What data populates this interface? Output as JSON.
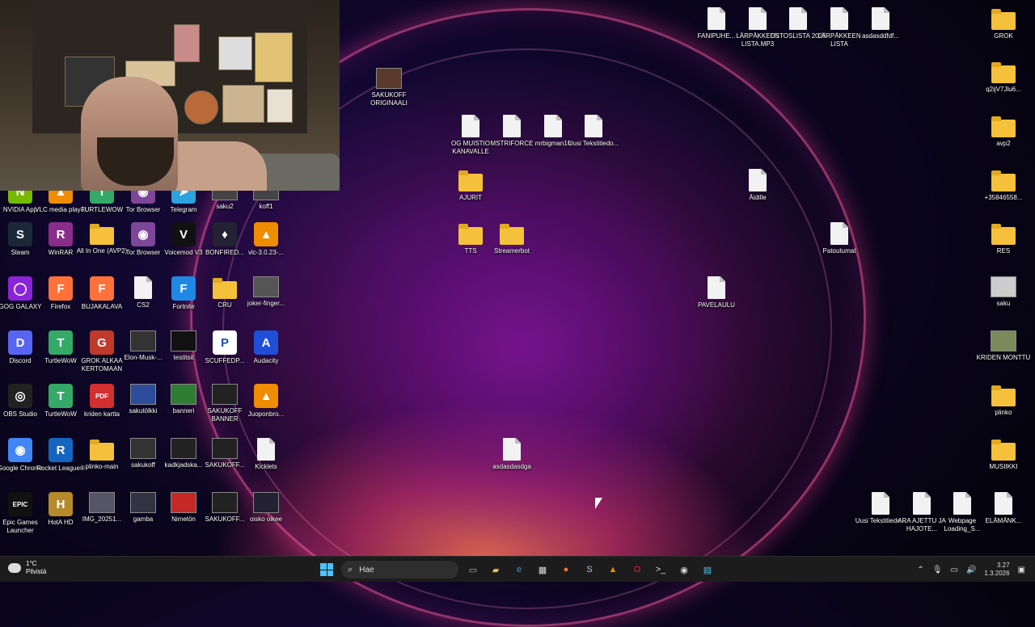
{
  "desktop_icons": [
    {
      "label": "NVIDIA App",
      "type": "app",
      "color": "#76b900",
      "glyph": "N"
    },
    {
      "label": "VLC media player",
      "type": "app",
      "color": "#f08c00",
      "glyph": "▲"
    },
    {
      "label": "TURTLEWOW",
      "type": "app",
      "color": "#3a6",
      "glyph": "T"
    },
    {
      "label": "Tor Browser",
      "type": "app",
      "color": "#7d4698",
      "glyph": "◉"
    },
    {
      "label": "Telegram",
      "type": "app",
      "color": "#2aa3de",
      "glyph": "➤"
    },
    {
      "label": "saku2",
      "type": "image",
      "color": "#444",
      "glyph": ""
    },
    {
      "label": "koff1",
      "type": "image",
      "color": "#444",
      "glyph": ""
    },
    {
      "label": "Steam",
      "type": "app",
      "color": "#1b2838",
      "glyph": "S"
    },
    {
      "label": "WinRAR",
      "type": "app",
      "color": "#8a2d8a",
      "glyph": "R"
    },
    {
      "label": "All In One (AVP2)",
      "type": "folder",
      "color": "#f5c13a",
      "glyph": ""
    },
    {
      "label": "Tor Browser",
      "type": "app",
      "color": "#7d4698",
      "glyph": "◉"
    },
    {
      "label": "Voicemod V3",
      "type": "app",
      "color": "#111",
      "glyph": "V"
    },
    {
      "label": "BONFIRED...",
      "type": "app",
      "color": "#223",
      "glyph": "♦"
    },
    {
      "label": "vlc-3.0.23-...",
      "type": "app",
      "color": "#f08c00",
      "glyph": "▲"
    },
    {
      "label": "GOG GALAXY",
      "type": "app",
      "color": "#8a24d8",
      "glyph": "◯"
    },
    {
      "label": "Firefox",
      "type": "app",
      "color": "#ff7139",
      "glyph": "F"
    },
    {
      "label": "BUJAKALAVA",
      "type": "app",
      "color": "#ff7139",
      "glyph": "F"
    },
    {
      "label": "CS2",
      "type": "doc",
      "color": "#f2f2f2",
      "glyph": ""
    },
    {
      "label": "Fortnite",
      "type": "app",
      "color": "#1e88e5",
      "glyph": "F"
    },
    {
      "label": "CRU",
      "type": "folder",
      "color": "#f5c13a",
      "glyph": ""
    },
    {
      "label": "joker-finger...",
      "type": "image",
      "color": "#555",
      "glyph": ""
    },
    {
      "label": "Discord",
      "type": "app",
      "color": "#5865f2",
      "glyph": "D"
    },
    {
      "label": "TurtleWoW",
      "type": "app",
      "color": "#3a6",
      "glyph": "T"
    },
    {
      "label": "GROK ALKAA KERTOMAAN",
      "type": "app",
      "color": "#c0392b",
      "glyph": "G"
    },
    {
      "label": "Elon-Musk-...",
      "type": "image",
      "color": "#333",
      "glyph": ""
    },
    {
      "label": "testitsit",
      "type": "image",
      "color": "#111",
      "glyph": ""
    },
    {
      "label": "SCUFFEDP...",
      "type": "app",
      "color": "#fff",
      "glyph": "P"
    },
    {
      "label": "Audacity",
      "type": "app",
      "color": "#1f4fd8",
      "glyph": "A"
    },
    {
      "label": "OBS Studio",
      "type": "app",
      "color": "#222",
      "glyph": "◎"
    },
    {
      "label": "TurtleWoW",
      "type": "app",
      "color": "#3a6",
      "glyph": "T"
    },
    {
      "label": "kriden kartta",
      "type": "app",
      "color": "#d32f2f",
      "glyph": "PDF"
    },
    {
      "label": "sakutölkki",
      "type": "image",
      "color": "#2d4c9c",
      "glyph": ""
    },
    {
      "label": "banneri",
      "type": "image",
      "color": "#2e7d32",
      "glyph": ""
    },
    {
      "label": "SAKUKOFF BANNER",
      "type": "image",
      "color": "#222",
      "glyph": ""
    },
    {
      "label": "Juoponbro...",
      "type": "app",
      "color": "#f08c00",
      "glyph": "▲"
    },
    {
      "label": "Google Chrome",
      "type": "app",
      "color": "#4285f4",
      "glyph": "◉"
    },
    {
      "label": "Rocket League®",
      "type": "app",
      "color": "#1565c0",
      "glyph": "R"
    },
    {
      "label": "plinko-main",
      "type": "folder",
      "color": "#f5c13a",
      "glyph": ""
    },
    {
      "label": "sakukoff",
      "type": "image",
      "color": "#333",
      "glyph": ""
    },
    {
      "label": "kadkjadska...",
      "type": "image",
      "color": "#222",
      "glyph": ""
    },
    {
      "label": "SAKUKOFF...",
      "type": "image",
      "color": "#222",
      "glyph": ""
    },
    {
      "label": "Kicklets",
      "type": "doc",
      "color": "#f2f2f2",
      "glyph": ""
    },
    {
      "label": "Epic Games Launcher",
      "type": "app",
      "color": "#111",
      "glyph": "EPIC"
    },
    {
      "label": "HotA HD",
      "type": "app",
      "color": "#b58a2a",
      "glyph": "H"
    },
    {
      "label": "IMG_20251...",
      "type": "image",
      "color": "#556",
      "glyph": ""
    },
    {
      "label": "gamba",
      "type": "image",
      "color": "#334",
      "glyph": ""
    },
    {
      "label": "Nimetön",
      "type": "image",
      "color": "#c62828",
      "glyph": ""
    },
    {
      "label": "SAKUKOFF...",
      "type": "image",
      "color": "#222",
      "glyph": ""
    },
    {
      "label": "oisko oikee",
      "type": "image",
      "color": "#223",
      "glyph": ""
    },
    {
      "label": "SAKUKOFF ORIGINAALI",
      "type": "image",
      "color": "#5a3a2a",
      "glyph": ""
    },
    {
      "label": "OG MUISTIO KANAVALLE",
      "type": "doc",
      "color": "#f2f2f2",
      "glyph": ""
    },
    {
      "label": "MSTRIFORCE",
      "type": "doc",
      "color": "#f2f2f2",
      "glyph": ""
    },
    {
      "label": "mrbigman10",
      "type": "doc",
      "color": "#f2f2f2",
      "glyph": ""
    },
    {
      "label": "Uusi Tekstitiedo...",
      "type": "doc",
      "color": "#f2f2f2",
      "glyph": ""
    },
    {
      "label": "AJURIT",
      "type": "folder",
      "color": "#f5c13a",
      "glyph": ""
    },
    {
      "label": "TTS",
      "type": "folder",
      "color": "#f5c13a",
      "glyph": ""
    },
    {
      "label": "Streamerbot",
      "type": "folder",
      "color": "#f5c13a",
      "glyph": ""
    },
    {
      "label": "asdasdasdga",
      "type": "doc",
      "color": "#f2f2f2",
      "glyph": ""
    },
    {
      "label": "FANIPUHE...",
      "type": "doc",
      "color": "#f2f2f2",
      "glyph": ""
    },
    {
      "label": "LÄRPÄKKEEN LISTA.MP3",
      "type": "doc",
      "color": "#f2f2f2",
      "glyph": ""
    },
    {
      "label": "OSTOSLISTA 2026",
      "type": "doc",
      "color": "#f2f2f2",
      "glyph": ""
    },
    {
      "label": "LÄRPÄKKEEN LISTA",
      "type": "doc",
      "color": "#f2f2f2",
      "glyph": ""
    },
    {
      "label": "asdasddfdf...",
      "type": "doc",
      "color": "#f2f2f2",
      "glyph": ""
    },
    {
      "label": "Äidille",
      "type": "doc",
      "color": "#f2f2f2",
      "glyph": ""
    },
    {
      "label": "Patoutumat",
      "type": "doc",
      "color": "#f2f2f2",
      "glyph": ""
    },
    {
      "label": "PAVELAULU",
      "type": "doc",
      "color": "#f2f2f2",
      "glyph": ""
    },
    {
      "label": "GROK",
      "type": "folder",
      "color": "#f5c13a",
      "glyph": ""
    },
    {
      "label": "q2ijV7Jlu6...",
      "type": "folder",
      "color": "#f5c13a",
      "glyph": ""
    },
    {
      "label": "avp2",
      "type": "folder",
      "color": "#f5c13a",
      "glyph": ""
    },
    {
      "label": "+35846558...",
      "type": "folder",
      "color": "#f5c13a",
      "glyph": ""
    },
    {
      "label": "RES",
      "type": "folder",
      "color": "#f5c13a",
      "glyph": ""
    },
    {
      "label": "saku",
      "type": "image",
      "color": "#ccc",
      "glyph": ""
    },
    {
      "label": "KRIDEN MONTTU",
      "type": "image",
      "color": "#7a8a5a",
      "glyph": ""
    },
    {
      "label": "plinko",
      "type": "folder",
      "color": "#f5c13a",
      "glyph": ""
    },
    {
      "label": "MUSIIKKI",
      "type": "folder",
      "color": "#f5c13a",
      "glyph": ""
    },
    {
      "label": "Uusi Tekstitiedo...",
      "type": "doc",
      "color": "#f2f2f2",
      "glyph": ""
    },
    {
      "label": "ARA AJETTU JA HAJOTE...",
      "type": "doc",
      "color": "#f2f2f2",
      "glyph": ""
    },
    {
      "label": "Webpage Loading_S...",
      "type": "doc",
      "color": "#f2f2f2",
      "glyph": ""
    },
    {
      "label": "ELÄMÄNK...",
      "type": "doc",
      "color": "#f2f2f2",
      "glyph": ""
    }
  ],
  "taskbar": {
    "weather_temp": "1°C",
    "weather_desc": "Pilvistä",
    "search_placeholder": "Hae",
    "apps": [
      {
        "name": "task-view",
        "glyph": "▭",
        "color": "#bbb"
      },
      {
        "name": "file-explorer",
        "glyph": "▰",
        "color": "#f5c13a"
      },
      {
        "name": "edge",
        "glyph": "e",
        "color": "#1fa2e0"
      },
      {
        "name": "store",
        "glyph": "▦",
        "color": "#ddd"
      },
      {
        "name": "firefox",
        "glyph": "●",
        "color": "#ff7139"
      },
      {
        "name": "steam",
        "glyph": "S",
        "color": "#9fc7e8"
      },
      {
        "name": "vlc",
        "glyph": "▲",
        "color": "#f08c00"
      },
      {
        "name": "opera",
        "glyph": "O",
        "color": "#ff1b2d"
      },
      {
        "name": "terminal",
        "glyph": ">_",
        "color": "#ddd"
      },
      {
        "name": "chrome",
        "glyph": "◉",
        "color": "#ddd"
      },
      {
        "name": "notepad",
        "glyph": "▤",
        "color": "#5bc0eb"
      }
    ],
    "time": "3.27",
    "date": "1.3.2026"
  }
}
